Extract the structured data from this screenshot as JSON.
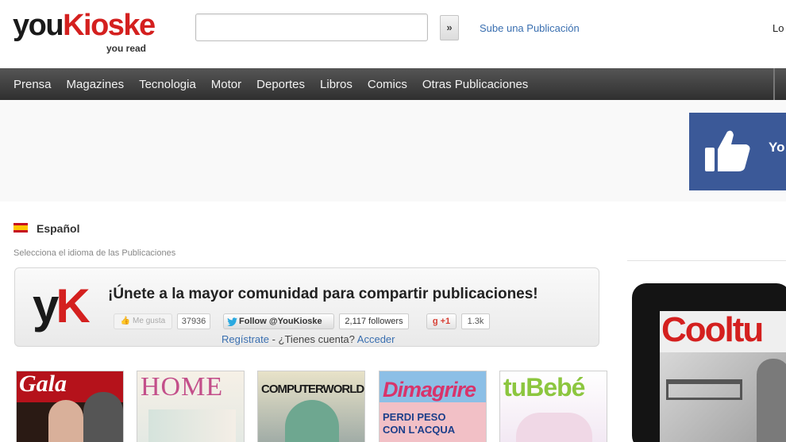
{
  "header": {
    "logo_you": "you",
    "logo_kioske": "Kioske",
    "logo_tagline": "you read",
    "search": {
      "value": "",
      "placeholder": ""
    },
    "search_button": "»",
    "upload_link": "Sube una Publicación",
    "login_link": "Lo"
  },
  "nav": {
    "items": [
      "Prensa",
      "Magazines",
      "Tecnologia",
      "Motor",
      "Deportes",
      "Libros",
      "Comics",
      "Otras Publicaciones"
    ]
  },
  "facebook_banner": {
    "text": "Yo",
    "icon": "thumbs-up-icon",
    "color": "#3b5998"
  },
  "language": {
    "label": "Español",
    "hint": "Selecciona el idioma de las Publicaciones",
    "flag_icon": "spain-flag-icon"
  },
  "community": {
    "logo_y": "y",
    "logo_k": "K",
    "title": "¡Únete a la mayor comunidad para compartir publicaciones!",
    "like_label": "Me gusta",
    "like_count": "37936",
    "follow_label": "Follow @YouKioske",
    "followers": "2,117 followers",
    "gplus_label": "+1",
    "gplus_count": "1.3k",
    "register_link": "Regístrate",
    "separator": " - ¿Tienes cuenta? ",
    "access_link": "Acceder"
  },
  "tablet": {
    "title": "Cooltu"
  },
  "magazines": [
    {
      "title": "Gala"
    },
    {
      "title": "HOME"
    },
    {
      "title": "COMPUTERWORLD"
    },
    {
      "title": "Dimagrire",
      "subtitle_1": "PERDI PESO",
      "subtitle_2": "CON L'ACQUA"
    },
    {
      "title": "tuBebé"
    }
  ],
  "colors": {
    "brand_red": "#d4201f",
    "nav_bg": "#3a3a3a",
    "link_blue": "#3a6fb0"
  }
}
